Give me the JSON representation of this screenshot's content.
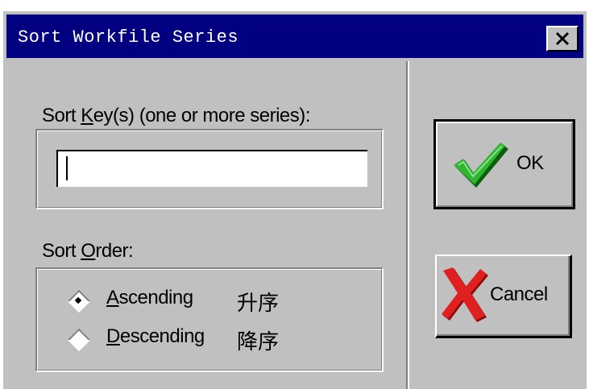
{
  "window": {
    "title": "Sort Workfile Series",
    "close_label": "×"
  },
  "sort_keys": {
    "label_pre": "Sort ",
    "label_accel": "K",
    "label_post": "ey(s) (one or more series):",
    "value": ""
  },
  "sort_order": {
    "label_pre": "Sort ",
    "label_accel": "O",
    "label_post": "rder:",
    "options": [
      {
        "accel": "A",
        "rest": "scending",
        "cjk": "升序",
        "selected": true
      },
      {
        "accel": "D",
        "rest": "escending",
        "cjk": "降序",
        "selected": false
      }
    ]
  },
  "buttons": {
    "ok_label": "OK",
    "cancel_label": "Cancel"
  },
  "icons": {
    "ok": "green-checkmark-icon",
    "cancel": "red-x-icon",
    "close": "close-icon"
  },
  "colors": {
    "titlebar": "#000080",
    "face": "#c0c0c0",
    "check": "#1f9a1f",
    "x": "#d01818"
  }
}
